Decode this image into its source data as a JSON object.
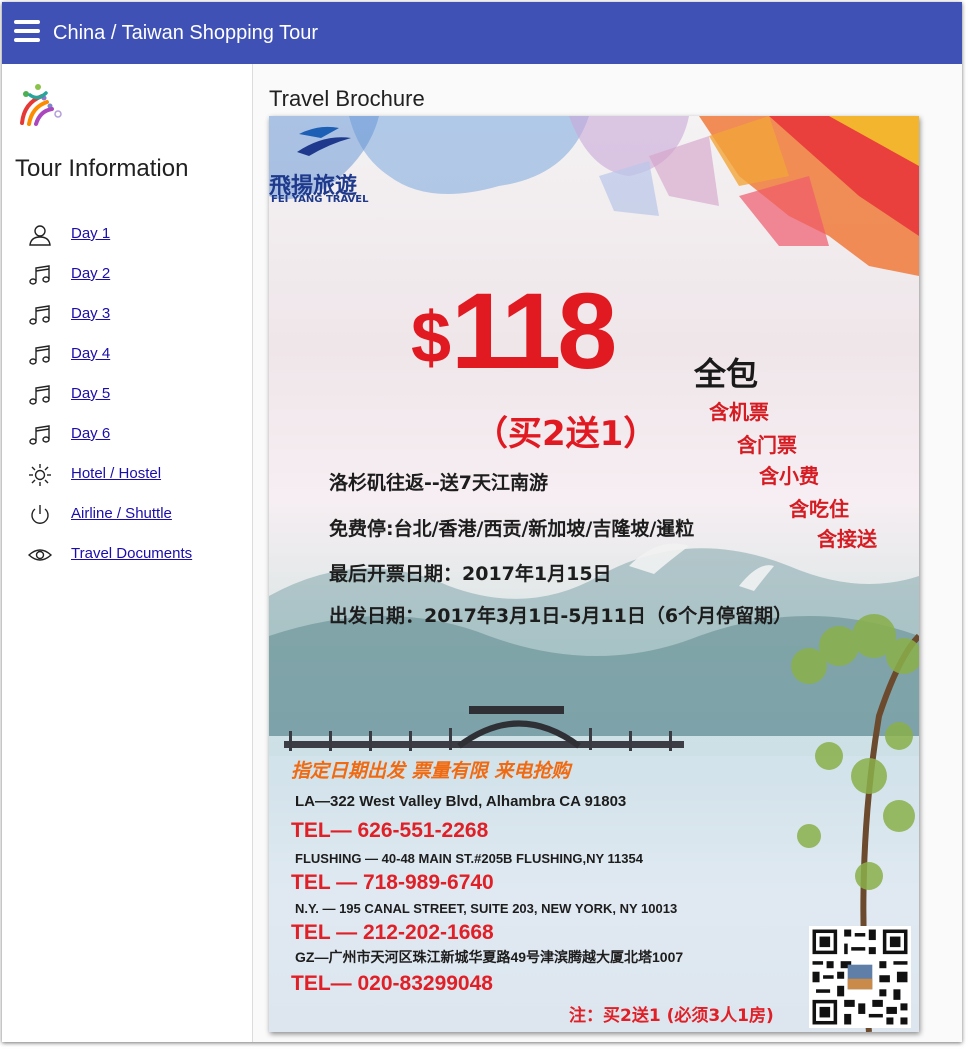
{
  "appbar": {
    "title": "China / Taiwan Shopping Tour"
  },
  "sidebar": {
    "heading": "Tour Information",
    "items": [
      {
        "label": "Day 1",
        "icon": "person-icon"
      },
      {
        "label": "Day 2",
        "icon": "music-note-icon"
      },
      {
        "label": "Day 3",
        "icon": "music-note-icon"
      },
      {
        "label": "Day 4",
        "icon": "music-note-icon"
      },
      {
        "label": "Day 5",
        "icon": "music-note-icon"
      },
      {
        "label": "Day 6",
        "icon": "music-note-icon"
      },
      {
        "label": "Hotel / Hostel",
        "icon": "sun-icon"
      },
      {
        "label": "Airline / Shuttle",
        "icon": "power-icon"
      },
      {
        "label": "Travel Documents",
        "icon": "eye-icon"
      }
    ]
  },
  "main": {
    "title": "Travel Brochure",
    "brochure": {
      "brand_cn": "飛揚旅遊",
      "brand_en": "FEI YANG TRAVEL",
      "price_symbol": "$",
      "price": "118",
      "price_suffix": "全包",
      "promo": "（买2送1）",
      "inclusions": [
        "含机票",
        "含门票",
        "含小费",
        "含吃住",
        "含接送"
      ],
      "line1": "洛杉矶往返--送7天江南游",
      "line2": "免费停:台北/香港/西贡/新加坡/吉隆坡/暹粒",
      "line3": "最后开票日期：2017年1月15日",
      "line4": "出发日期：2017年3月1日-5月11日（6个月停留期）",
      "banner": "指定日期出发 票量有限 来电抢购",
      "offices": [
        {
          "address": "LA—322 West Valley Blvd, Alhambra CA 91803",
          "tel": "TEL— 626-551-2268"
        },
        {
          "address": "FLUSHING — 40-48 MAIN ST.#205B FLUSHING,NY 11354",
          "tel": "TEL — 718-989-6740"
        },
        {
          "address": "N.Y. — 195 CANAL STREET, SUITE 203, NEW YORK, NY 10013",
          "tel": "TEL — 212-202-1668"
        },
        {
          "address": "GZ—广州市天河区珠江新城华夏路49号津滨腾越大厦北塔1007",
          "tel": "TEL— 020-83299048"
        }
      ],
      "note": "注：买2送1 (必须3人1房)"
    }
  },
  "colors": {
    "appbar": "#3f51b5",
    "link": "#1a0dab",
    "price_red": "#e11a22"
  }
}
